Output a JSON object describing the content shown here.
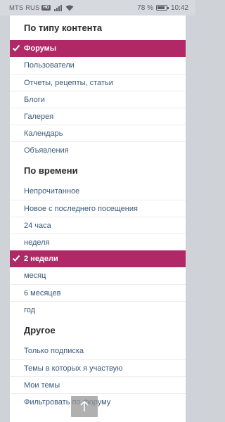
{
  "status": {
    "carrier": "MTS RUS",
    "network_badge": "HD",
    "battery": "78 %",
    "time": "10:42"
  },
  "content_type": {
    "title": "По типу контента",
    "items": [
      {
        "label": "Форумы",
        "active": true
      },
      {
        "label": "Пользователи"
      },
      {
        "label": "Отчеты, рецепты, статьи"
      },
      {
        "label": "Блоги"
      },
      {
        "label": "Галерея"
      },
      {
        "label": "Календарь"
      },
      {
        "label": "Объявления"
      }
    ]
  },
  "time": {
    "title": "По времени",
    "items": [
      {
        "label": "Непрочитанное"
      },
      {
        "label": "Новое с последнего посещения"
      },
      {
        "label": "24 часа"
      },
      {
        "label": "неделя"
      },
      {
        "label": "2 недели",
        "active": true
      },
      {
        "label": "месяц"
      },
      {
        "label": "6 месяцев"
      },
      {
        "label": "год"
      }
    ]
  },
  "other": {
    "title": "Другое",
    "items": [
      {
        "label": "Только подписка"
      },
      {
        "label": "Темы в которых я участвую"
      },
      {
        "label": "Мои темы"
      },
      {
        "label": "Фильтровать по форуму"
      }
    ]
  },
  "scroll_top_icon": "arrow-up-icon",
  "colors": {
    "active_bg": "#b02866",
    "link": "#3a5a7a"
  }
}
